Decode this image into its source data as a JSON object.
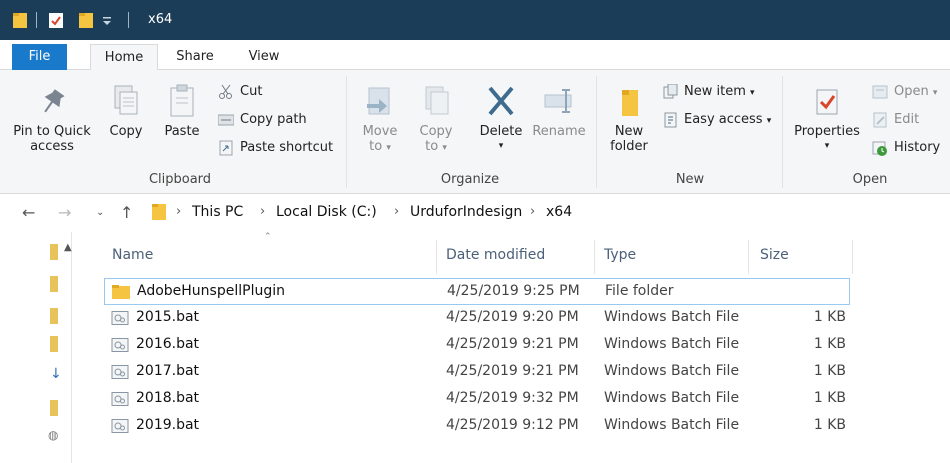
{
  "window": {
    "title": "x64"
  },
  "tabs": [
    "File",
    "Home",
    "Share",
    "View"
  ],
  "ribbon": {
    "clipboard": {
      "label": "Clipboard",
      "pin_label_1": "Pin to Quick",
      "pin_label_2": "access",
      "copy": "Copy",
      "paste": "Paste",
      "cut": "Cut",
      "copy_path": "Copy path",
      "paste_shortcut": "Paste shortcut"
    },
    "organize": {
      "label": "Organize",
      "move_1": "Move",
      "move_2": "to",
      "copy_1": "Copy",
      "copy_2": "to",
      "delete": "Delete",
      "rename": "Rename"
    },
    "new": {
      "label": "New",
      "new_folder_1": "New",
      "new_folder_2": "folder",
      "new_item": "New item",
      "easy_access": "Easy access"
    },
    "open": {
      "label": "Open",
      "properties": "Properties",
      "open": "Open",
      "edit": "Edit",
      "history": "History"
    }
  },
  "address": {
    "crumbs": [
      "This PC",
      "Local Disk (C:)",
      "UrduforIndesign",
      "x64"
    ]
  },
  "columns": {
    "name": "Name",
    "date": "Date modified",
    "type": "Type",
    "size": "Size"
  },
  "files": [
    {
      "name": "AdobeHunspellPlugin",
      "date": "4/25/2019 9:25 PM",
      "type": "File folder",
      "size": "",
      "kind": "folder"
    },
    {
      "name": "2015.bat",
      "date": "4/25/2019 9:20 PM",
      "type": "Windows Batch File",
      "size": "1 KB",
      "kind": "bat"
    },
    {
      "name": "2016.bat",
      "date": "4/25/2019 9:21 PM",
      "type": "Windows Batch File",
      "size": "1 KB",
      "kind": "bat"
    },
    {
      "name": "2017.bat",
      "date": "4/25/2019 9:21 PM",
      "type": "Windows Batch File",
      "size": "1 KB",
      "kind": "bat"
    },
    {
      "name": "2018.bat",
      "date": "4/25/2019 9:32 PM",
      "type": "Windows Batch File",
      "size": "1 KB",
      "kind": "bat"
    },
    {
      "name": "2019.bat",
      "date": "4/25/2019 9:12 PM",
      "type": "Windows Batch File",
      "size": "1 KB",
      "kind": "bat"
    }
  ],
  "colors": {
    "titlebar": "#1c3d57",
    "file_tab": "#1979ca",
    "folder": "#f5c541",
    "selection_border": "#99c9f0"
  }
}
